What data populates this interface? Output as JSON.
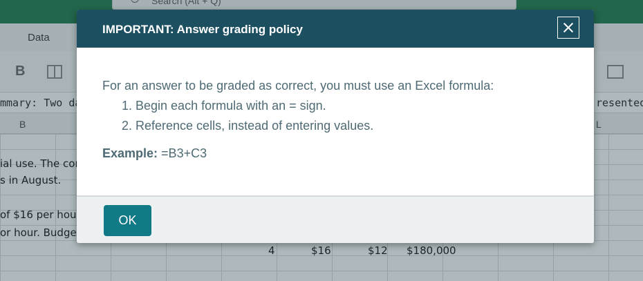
{
  "excel": {
    "search_placeholder": "Search (Alt + Q)",
    "menu": {
      "data_tab": "Data"
    },
    "ribbon": {
      "bold_label": "B"
    },
    "formula_bar": {
      "left_text": "mmary: Two da",
      "right_text": "resented"
    },
    "columns": {
      "b": "B",
      "l": "L"
    },
    "cells": {
      "r1": "ial use. The cor",
      "r2": "s in August.",
      "r3": "of $16 per hou",
      "r4": "or hour. Budget",
      "n1": "4",
      "n2": "$16",
      "n3": "$12",
      "n4": "$180,000"
    }
  },
  "modal": {
    "title": "IMPORTANT: Answer grading policy",
    "close_label": "Close",
    "intro": "For an answer to be graded as correct, you must use an Excel formula:",
    "steps": [
      "1. Begin each formula with an = sign.",
      "2. Reference cells, instead of entering values."
    ],
    "example_label": "Example:",
    "example_value": " =B3+C3",
    "ok_label": "OK"
  },
  "colors": {
    "header": "#1c4f60",
    "ok_button": "#117a86",
    "body_text": "#4e6a74",
    "excel_green": "#1f7a4a"
  }
}
